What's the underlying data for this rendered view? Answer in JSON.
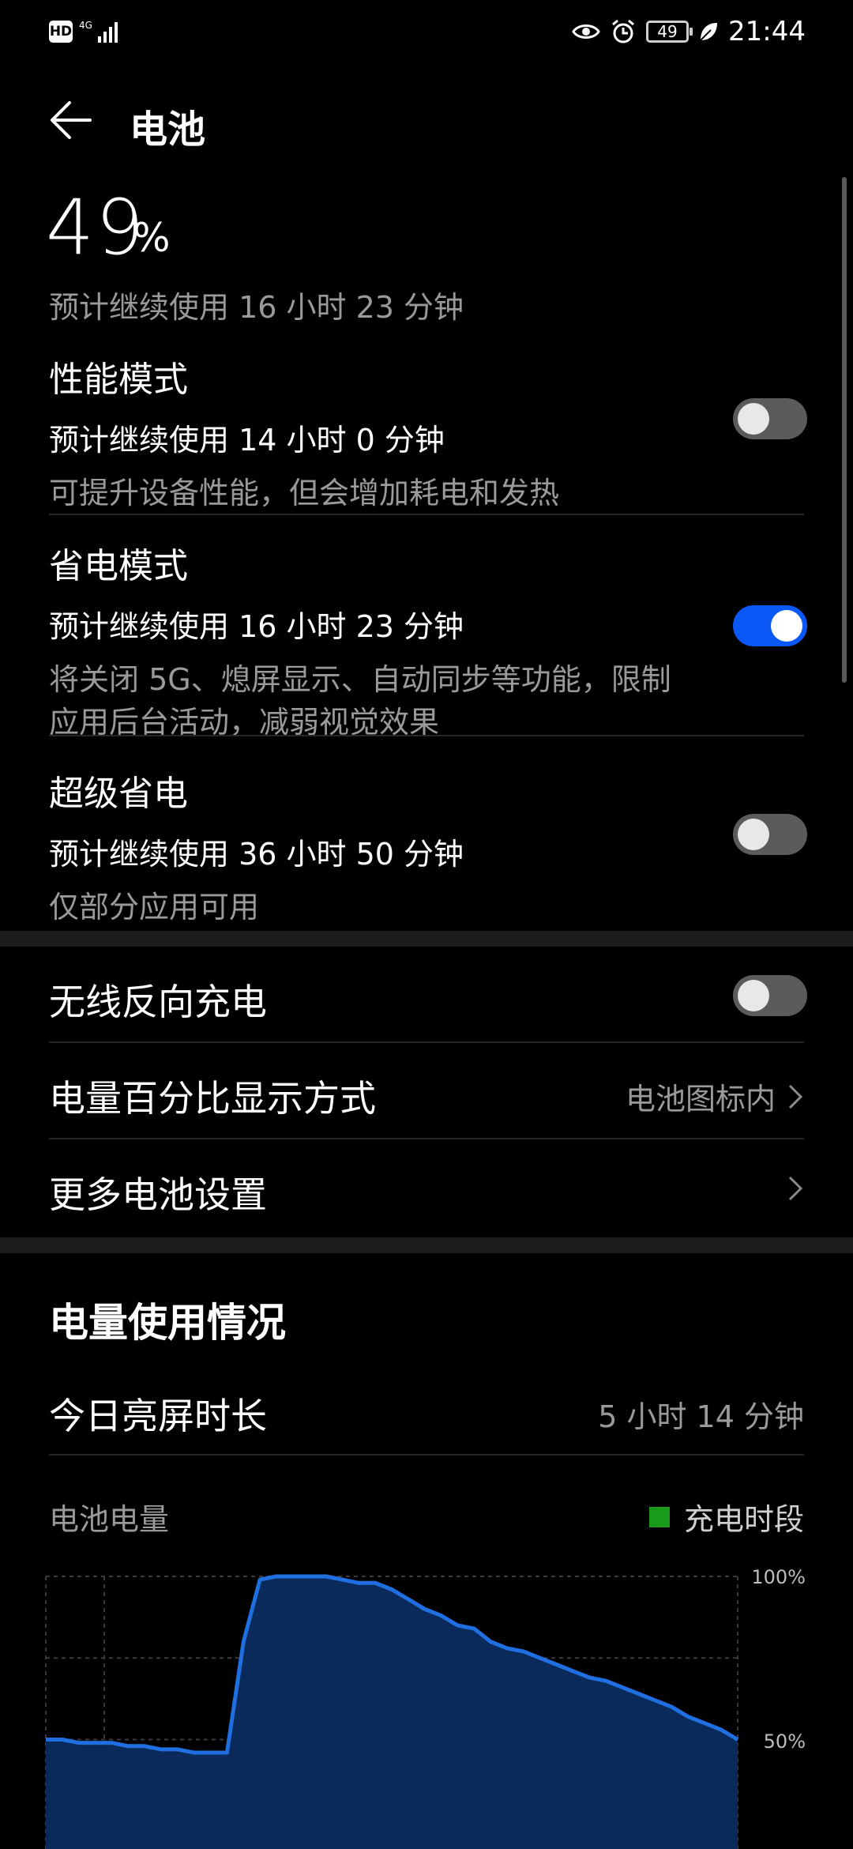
{
  "status_bar": {
    "hd": "HD",
    "network": "4G",
    "battery_level": "49",
    "time": "21:44"
  },
  "header": {
    "title": "电池"
  },
  "summary": {
    "percent": "49",
    "percent_unit": "%",
    "estimate": "预计继续使用 16 小时 23 分钟"
  },
  "modes": [
    {
      "title": "性能模式",
      "estimate": "预计继续使用 14 小时 0 分钟",
      "description": "可提升设备性能，但会增加耗电和发热",
      "enabled": false
    },
    {
      "title": "省电模式",
      "estimate": "预计继续使用 16 小时 23 分钟",
      "description": "将关闭 5G、熄屏显示、自动同步等功能，限制应用后台活动，减弱视觉效果",
      "enabled": true
    },
    {
      "title": "超级省电",
      "estimate": "预计继续使用 36 小时 50 分钟",
      "description": "仅部分应用可用",
      "enabled": false
    }
  ],
  "settings": {
    "wireless_reverse_charging": {
      "label": "无线反向充电",
      "enabled": false
    },
    "percentage_display": {
      "label": "电量百分比显示方式",
      "value": "电池图标内"
    },
    "more_settings": {
      "label": "更多电池设置"
    }
  },
  "usage": {
    "title": "电量使用情况",
    "screen_on_label": "今日亮屏时长",
    "screen_on_value": "5 小时 14 分钟",
    "battery_label": "电池电量",
    "legend_charging": "充电时段"
  },
  "colors": {
    "accent": "#0a59f7",
    "line": "#1f6fe0",
    "fill_blue": "#0b2a5c",
    "charging": "#1a9a1a"
  },
  "chart_data": {
    "type": "area",
    "title": "",
    "xlabel": "",
    "ylabel": "",
    "ylim": [
      0,
      100
    ],
    "y_tick_labels": [
      "100%",
      "50%"
    ],
    "series": [
      {
        "values": [
          50,
          50,
          49,
          49,
          49,
          48,
          48,
          47,
          47,
          46,
          46,
          46,
          80,
          99,
          100,
          100,
          100,
          100,
          99,
          98,
          98,
          96,
          93,
          90,
          88,
          85,
          84,
          80,
          78,
          77,
          75,
          73,
          71,
          69,
          68,
          66,
          64,
          62,
          60,
          57,
          55,
          53,
          50
        ]
      }
    ],
    "charging_ranges_index": [
      [
        11,
        15
      ],
      [
        40,
        42
      ]
    ]
  }
}
